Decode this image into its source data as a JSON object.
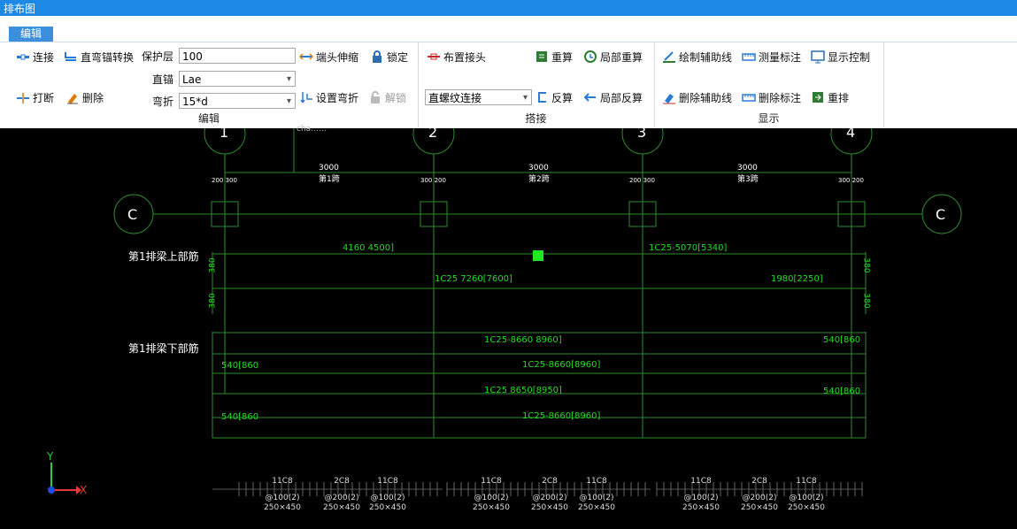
{
  "window": {
    "title": "排布图"
  },
  "tabs": [
    {
      "label": "编辑"
    }
  ],
  "toolbar": {
    "edit": {
      "connect": "连接",
      "straight_anchor_convert": "直弯锚转换",
      "cover_label": "保护层",
      "cover_value": "100",
      "end_extend": "端头伸缩",
      "lock": "锁定",
      "break": "打断",
      "delete": "删除",
      "straight_anchor_label": "直锚",
      "straight_anchor_value": "Lae",
      "bend_label": "弯折",
      "bend_value": "15*d",
      "set_bend": "设置弯折",
      "unlock": "解锁",
      "group_name": "编辑"
    },
    "splice": {
      "place_joint": "布置接头",
      "recalc": "重算",
      "local_recalc": "局部重算",
      "connection_type": "直螺纹连接",
      "reverse_calc": "反算",
      "local_reverse": "局部反算",
      "group_name": "搭接"
    },
    "display": {
      "draw_aux": "绘制辅助线",
      "measure_mark": "测量标注",
      "display_control": "显示控制",
      "delete_aux": "删除辅助线",
      "delete_mark": "删除标注",
      "rearrange": "重排",
      "group_name": "显示"
    }
  },
  "drawing": {
    "axes": [
      "1",
      "2",
      "3",
      "4"
    ],
    "row_axis": "C",
    "obscured_label": "cha……",
    "span_lengths": [
      "3000",
      "3000",
      "3000"
    ],
    "span_names": [
      "第1跨",
      "第2跨",
      "第3跨"
    ],
    "column_offsets": [
      "200 300",
      "300 200",
      "200 300",
      "300 200"
    ],
    "top_rebar_title": "第1排梁上部筋",
    "bottom_rebar_title": "第1排梁下部筋",
    "top_bars": [
      "4160 4500]",
      "1C25-5070[5340]",
      "1C25  7260[7600]",
      "1980[2250]"
    ],
    "bottom_bars": [
      "1C25-8660 8960]",
      "1C25-8660[8960]",
      "1C25  8650[8950]",
      "1C25-8660[8960]"
    ],
    "bottom_side_left": [
      "540[860",
      "540[860"
    ],
    "bottom_side_right": [
      "540[860",
      "540[860"
    ],
    "row_heights": [
      "380",
      "380",
      "380",
      "380"
    ],
    "stirrups": [
      {
        "count": "11C8",
        "spacing": "@100(2)",
        "size": "250×450"
      },
      {
        "count": "2C8",
        "spacing": "@200(2)",
        "size": "250×450"
      },
      {
        "count": "11C8",
        "spacing": "@100(2)",
        "size": "250×450"
      },
      {
        "count": "11C8",
        "spacing": "@100(2)",
        "size": "250×450"
      },
      {
        "count": "2C8",
        "spacing": "@200(2)",
        "size": "250×450"
      },
      {
        "count": "11C8",
        "spacing": "@100(2)",
        "size": "250×450"
      },
      {
        "count": "11C8",
        "spacing": "@100(2)",
        "size": "250×450"
      },
      {
        "count": "2C8",
        "spacing": "@200(2)",
        "size": "250×450"
      },
      {
        "count": "11C8",
        "spacing": "@100(2)",
        "size": "250×450"
      }
    ],
    "ucs": {
      "x": "X",
      "y": "Y"
    }
  },
  "colors": {
    "accent": "#1e88e5",
    "rebar": "#22dd22",
    "grid": "#2e8b2e",
    "canvas": "#000000"
  }
}
